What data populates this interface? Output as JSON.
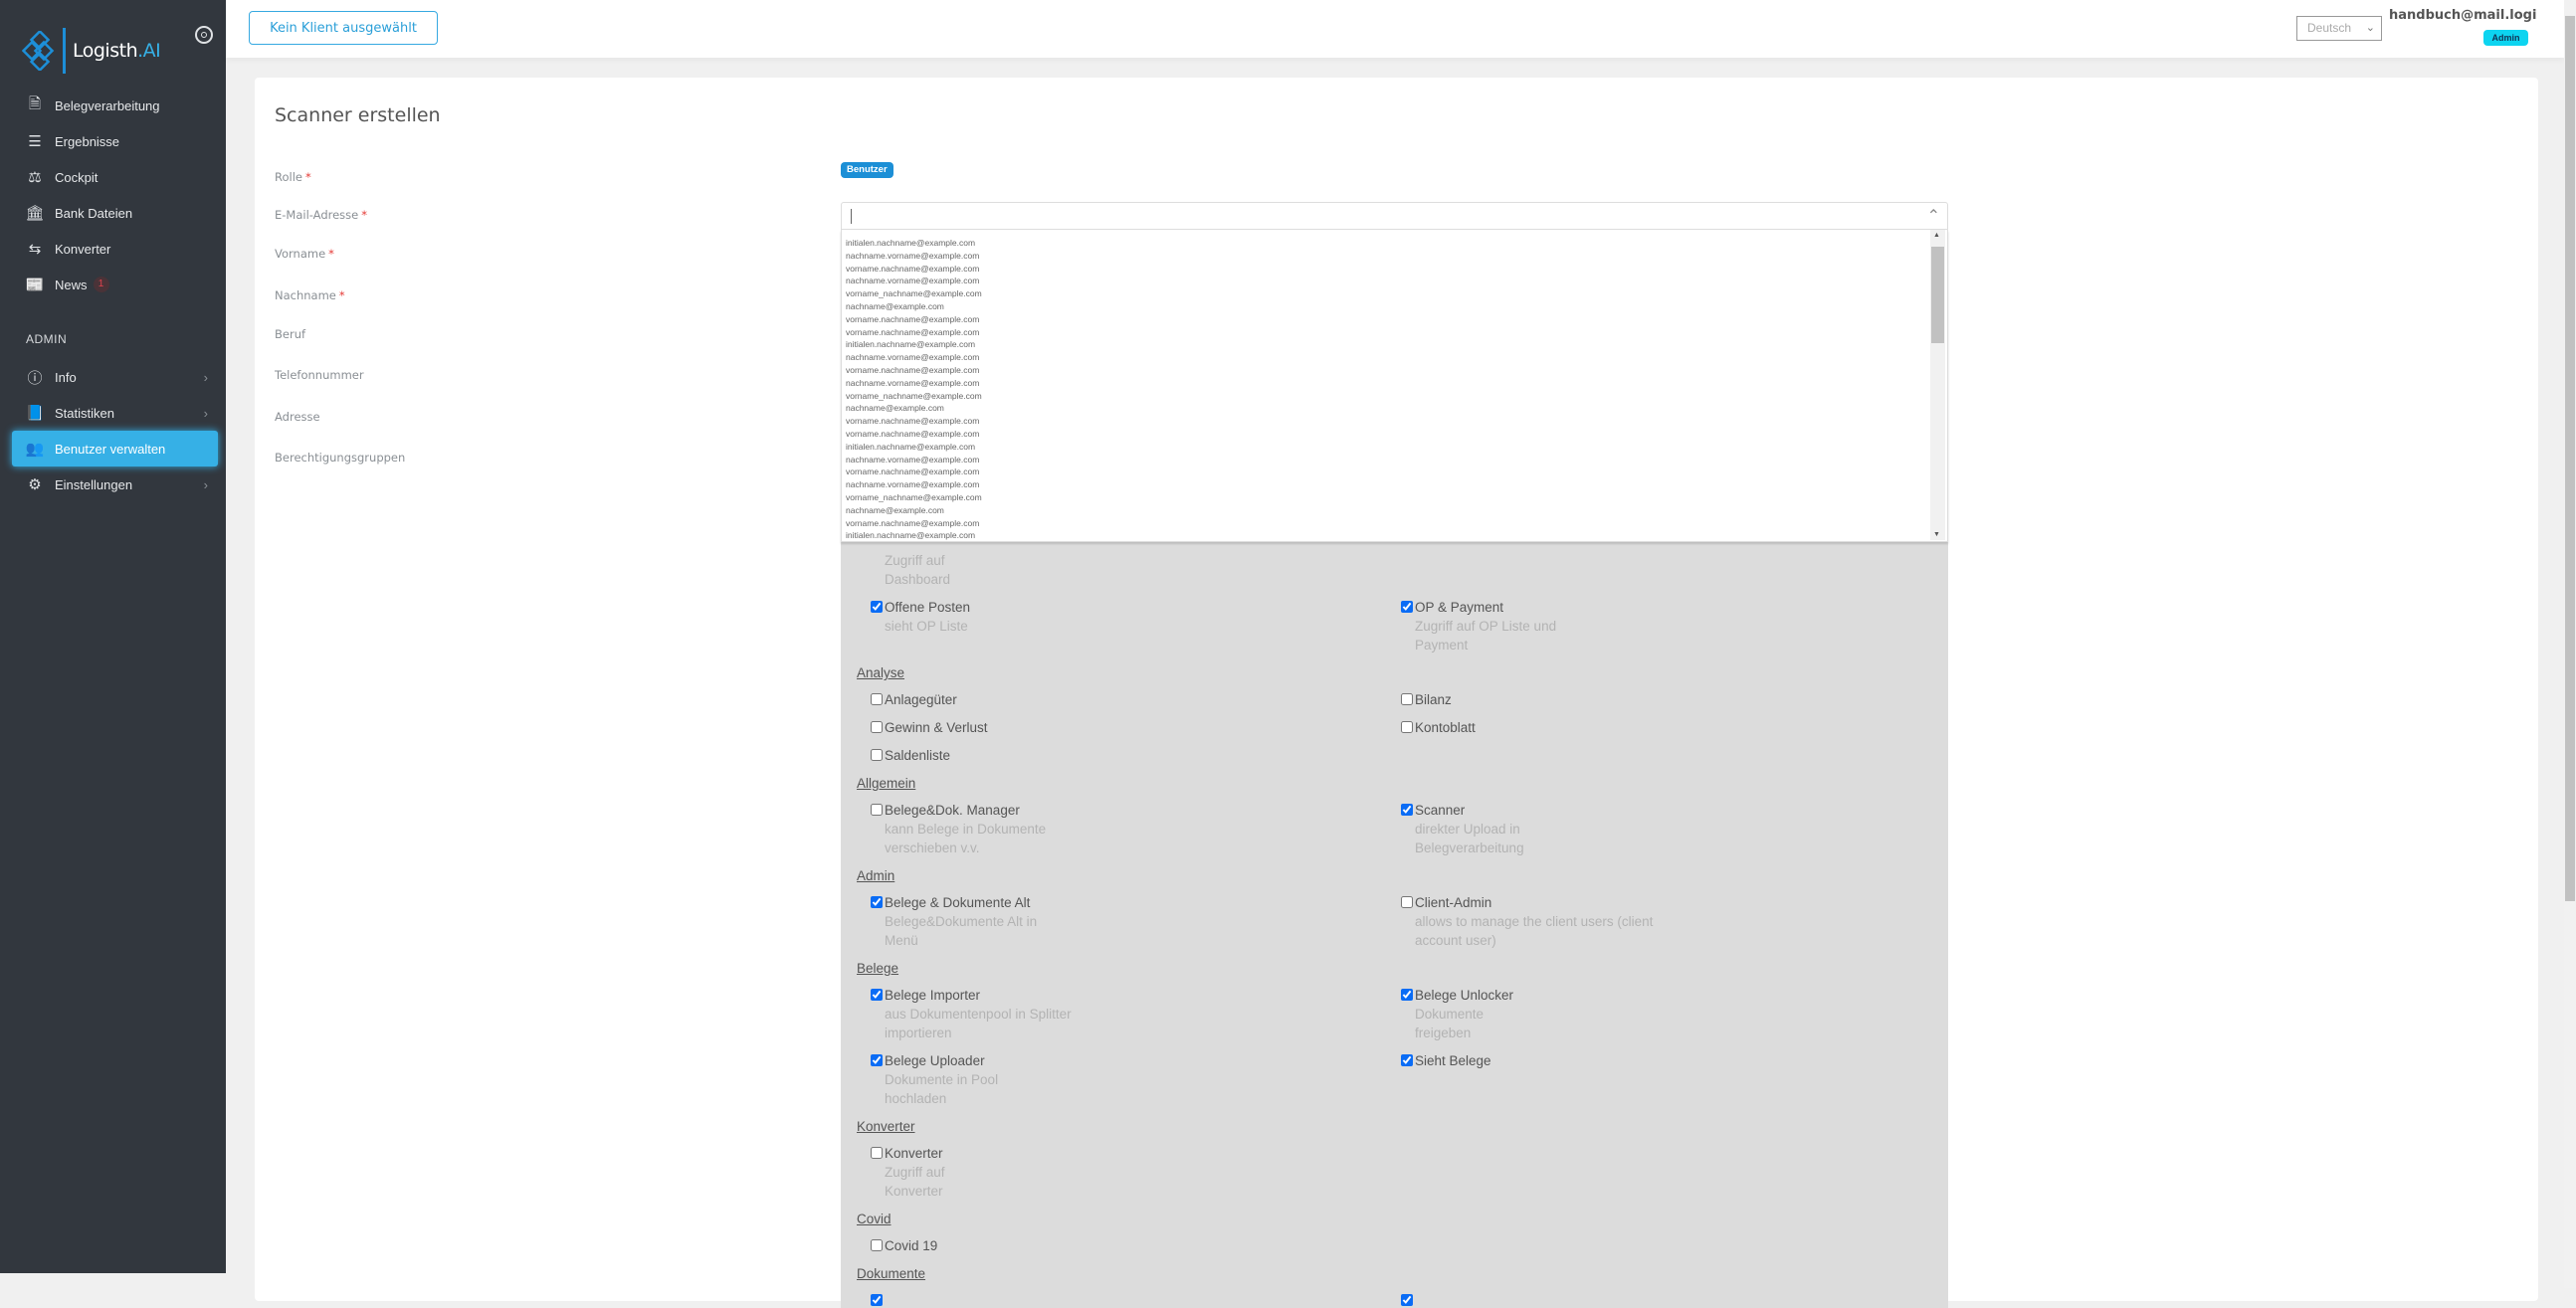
{
  "sidebar": {
    "logo": {
      "text": "Logisth",
      "accent": ".AI"
    },
    "items": [
      {
        "label": "Belegverarbeitung",
        "icon": "document-icon"
      },
      {
        "label": "Ergebnisse",
        "icon": "list-icon"
      },
      {
        "label": "Cockpit",
        "icon": "scale-icon"
      },
      {
        "label": "Bank Dateien",
        "icon": "bank-icon"
      },
      {
        "label": "Konverter",
        "icon": "exchange-icon"
      },
      {
        "label": "News",
        "icon": "newspaper-icon",
        "badge": "1"
      }
    ],
    "admin_heading": "ADMIN",
    "admin_items": [
      {
        "label": "Info",
        "icon": "info-icon"
      },
      {
        "label": "Statistiken",
        "icon": "book-icon"
      },
      {
        "label": "Benutzer verwalten",
        "icon": "users-icon",
        "active": true
      },
      {
        "label": "Einstellungen",
        "icon": "gears-icon"
      }
    ]
  },
  "topbar": {
    "client_button": "Kein Klient ausgewählt",
    "language": "Deutsch",
    "user_email": "handbuch@mail.logi",
    "user_role": "Admin"
  },
  "form": {
    "title": "Scanner erstellen",
    "labels": {
      "role": "Rolle",
      "email": "E-Mail-Adresse",
      "firstname": "Vorname",
      "lastname": "Nachname",
      "job": "Beruf",
      "phone": "Telefonnummer",
      "address": "Adresse",
      "groups": "Berechtigungsgruppen"
    },
    "required_mark": "*",
    "role_value": "Benutzer",
    "email_value": "",
    "email_suggestions": [
      "initialen.nachname@example.com",
      "nachname.vorname@example.com",
      "vorname.nachname@example.com",
      "nachname.vorname@example.com",
      "vorname_nachname@example.com",
      "nachname@example.com",
      "vorname.nachname@example.com",
      "vorname.nachname@example.com",
      "initialen.nachname@example.com",
      "nachname.vorname@example.com",
      "vorname.nachname@example.com",
      "nachname.vorname@example.com",
      "vorname_nachname@example.com",
      "nachname@example.com",
      "vorname.nachname@example.com",
      "vorname.nachname@example.com",
      "initialen.nachname@example.com",
      "nachname.vorname@example.com",
      "vorname.nachname@example.com",
      "nachname.vorname@example.com",
      "vorname_nachname@example.com",
      "nachname@example.com",
      "vorname.nachname@example.com",
      "initialen.nachname@example.com"
    ]
  },
  "permissions": [
    {
      "section": null,
      "rows": [
        [
          {
            "label": null,
            "checked": null,
            "desc": [
              "Zugriff auf",
              "Dashboard"
            ]
          },
          null
        ],
        [
          {
            "label": "Offene Posten",
            "checked": true,
            "desc": [
              "sieht OP Liste"
            ]
          },
          {
            "label": "OP & Payment",
            "checked": true,
            "desc": [
              "Zugriff auf OP Liste und",
              "Payment"
            ]
          }
        ]
      ]
    },
    {
      "section": "Analyse",
      "rows": [
        [
          {
            "label": "Anlagegüter",
            "checked": false,
            "desc": []
          },
          {
            "label": "Bilanz",
            "checked": false,
            "desc": []
          }
        ],
        [
          {
            "label": "Gewinn & Verlust",
            "checked": false,
            "desc": []
          },
          {
            "label": "Kontoblatt",
            "checked": false,
            "desc": []
          }
        ],
        [
          {
            "label": "Saldenliste",
            "checked": false,
            "desc": []
          },
          null
        ]
      ]
    },
    {
      "section": "Allgemein",
      "rows": [
        [
          {
            "label": "Belege&Dok. Manager",
            "checked": false,
            "desc": [
              "kann Belege in Dokumente",
              "verschieben v.v."
            ]
          },
          {
            "label": "Scanner",
            "checked": true,
            "desc": [
              "direkter Upload in",
              "Belegverarbeitung"
            ]
          }
        ]
      ]
    },
    {
      "section": "Admin",
      "rows": [
        [
          {
            "label": "Belege & Dokumente Alt",
            "checked": true,
            "desc": [
              "Belege&Dokumente Alt in",
              "Menü"
            ]
          },
          {
            "label": "Client-Admin",
            "checked": false,
            "desc": [
              "allows to manage the client users (client",
              "account user)"
            ]
          }
        ]
      ]
    },
    {
      "section": "Belege",
      "rows": [
        [
          {
            "label": "Belege Importer",
            "checked": true,
            "desc": [
              "aus Dokumentenpool in Splitter",
              "importieren"
            ]
          },
          {
            "label": "Belege Unlocker",
            "checked": true,
            "desc": [
              "Dokumente",
              "freigeben"
            ]
          }
        ],
        [
          {
            "label": "Belege Uploader",
            "checked": true,
            "desc": [
              "Dokumente in Pool",
              "hochladen"
            ]
          },
          {
            "label": "Sieht Belege",
            "checked": true,
            "desc": []
          }
        ]
      ]
    },
    {
      "section": "Konverter",
      "rows": [
        [
          {
            "label": "Konverter",
            "checked": false,
            "desc": [
              "Zugriff auf",
              "Konverter"
            ]
          },
          null
        ]
      ]
    },
    {
      "section": "Covid",
      "rows": [
        [
          {
            "label": "Covid 19",
            "checked": false,
            "desc": []
          },
          null
        ]
      ]
    },
    {
      "section": "Dokumente",
      "rows": [
        [
          {
            "label": "",
            "checked": true,
            "desc": []
          },
          {
            "label": "",
            "checked": true,
            "desc": []
          }
        ]
      ]
    }
  ],
  "colors": {
    "sidebar": "#32373e",
    "accent": "#36b0e6",
    "panel": "#dcdcdc",
    "admin_badge": "#0dd4f0"
  }
}
